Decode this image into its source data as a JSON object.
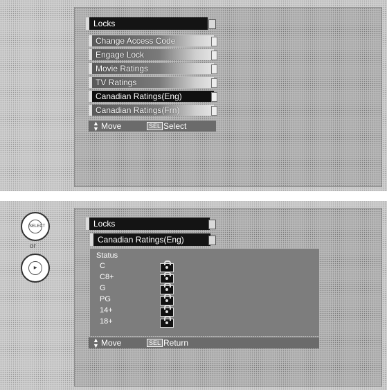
{
  "top_screen": {
    "header": "Locks",
    "menu_items": [
      {
        "label": "Change Access Code"
      },
      {
        "label": "Engage Lock"
      },
      {
        "label": "Movie Ratings"
      },
      {
        "label": "TV Ratings"
      },
      {
        "label": "Canadian Ratings(Eng)"
      },
      {
        "label": "Canadian Ratings(Frn)"
      }
    ],
    "selected_index": 4,
    "footer": {
      "move_label": "Move",
      "sel_badge": "SEL",
      "action_label": "Select"
    }
  },
  "bottom_screen": {
    "header": "Locks",
    "sub_header": "Canadian Ratings(Eng)",
    "status_title": "Status",
    "ratings": [
      {
        "label": "C",
        "locked": true
      },
      {
        "label": "C8+",
        "locked": true
      },
      {
        "label": "G",
        "locked": true
      },
      {
        "label": "PG",
        "locked": true
      },
      {
        "label": "14+",
        "locked": true
      },
      {
        "label": "18+",
        "locked": true
      }
    ],
    "footer": {
      "move_label": "Move",
      "sel_badge": "SEL",
      "action_label": "Return"
    }
  },
  "remote": {
    "select_button_label": "SELECT",
    "or_text": "or"
  }
}
